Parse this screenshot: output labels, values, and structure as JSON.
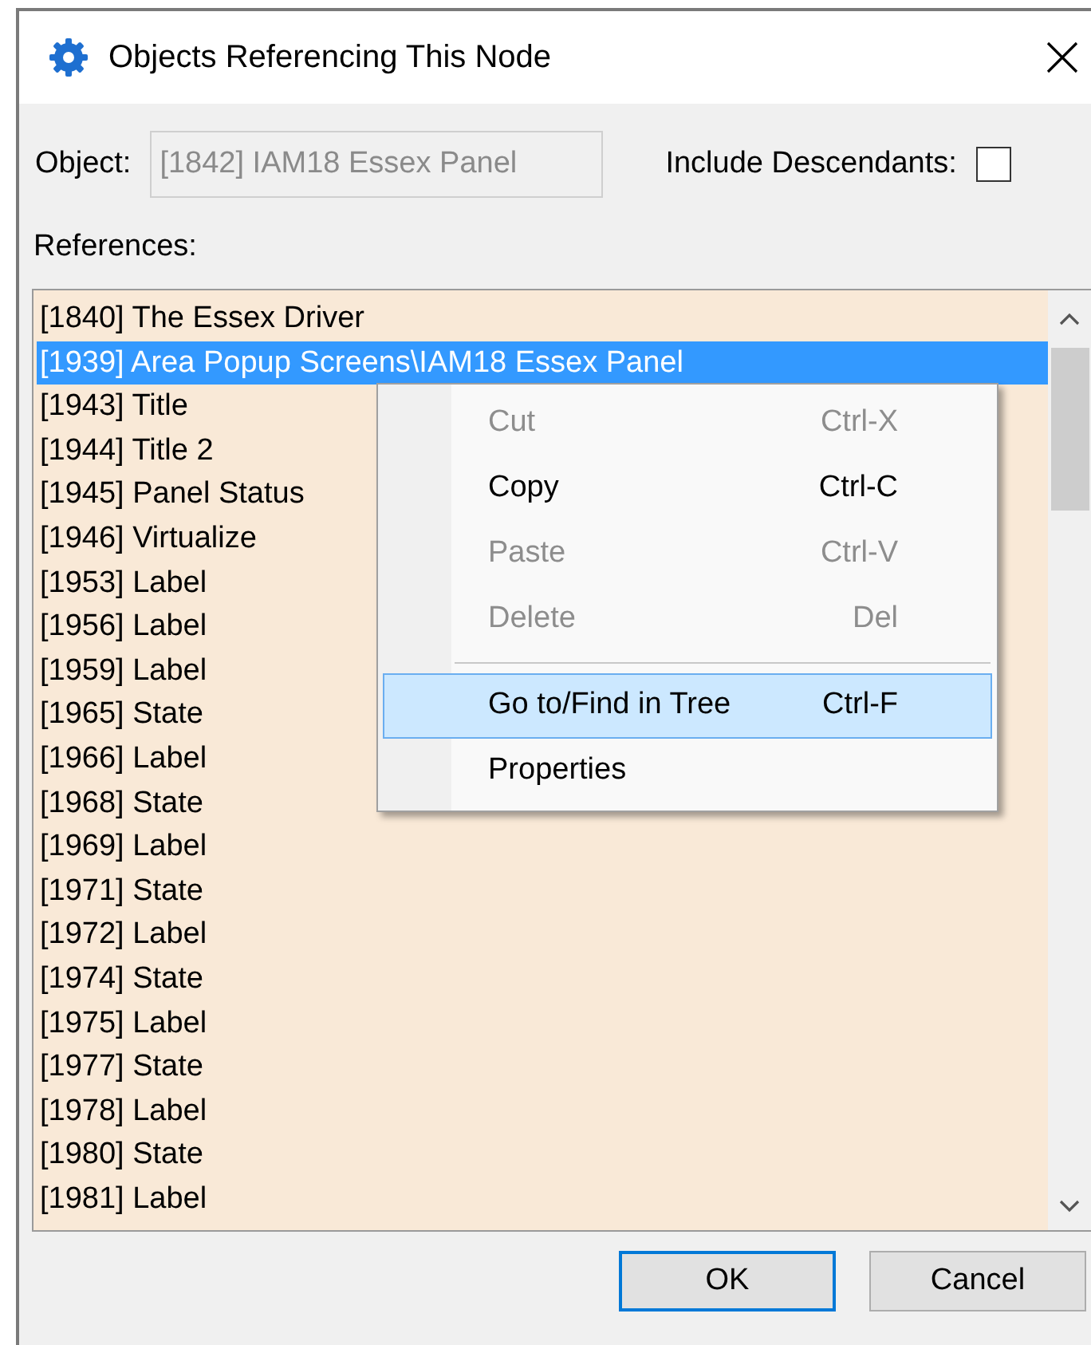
{
  "window": {
    "title": "Objects Referencing This Node"
  },
  "object_field": {
    "label": "Object:",
    "value": "[1842] IAM18 Essex Panel",
    "disabled": true
  },
  "include_descendants": {
    "label": "Include Descendants:",
    "checked": false
  },
  "references": {
    "label": "References:",
    "items": [
      {
        "text": "[1840] The Essex Driver",
        "selected": false
      },
      {
        "text": "[1939] Area Popup Screens\\IAM18 Essex Panel",
        "selected": true
      },
      {
        "text": "[1943] Title",
        "selected": false
      },
      {
        "text": "[1944] Title 2",
        "selected": false
      },
      {
        "text": "[1945] Panel Status",
        "selected": false
      },
      {
        "text": "[1946] Virtualize",
        "selected": false
      },
      {
        "text": "[1953] Label",
        "selected": false
      },
      {
        "text": "[1956] Label",
        "selected": false
      },
      {
        "text": "[1959] Label",
        "selected": false
      },
      {
        "text": "[1965] State",
        "selected": false
      },
      {
        "text": "[1966] Label",
        "selected": false
      },
      {
        "text": "[1968] State",
        "selected": false
      },
      {
        "text": "[1969] Label",
        "selected": false
      },
      {
        "text": "[1971] State",
        "selected": false
      },
      {
        "text": "[1972] Label",
        "selected": false
      },
      {
        "text": "[1974] State",
        "selected": false
      },
      {
        "text": "[1975] Label",
        "selected": false
      },
      {
        "text": "[1977] State",
        "selected": false
      },
      {
        "text": "[1978] Label",
        "selected": false
      },
      {
        "text": "[1980] State",
        "selected": false
      },
      {
        "text": "[1981] Label",
        "selected": false
      }
    ]
  },
  "context_menu": {
    "items": [
      {
        "kind": "item",
        "label": "Cut",
        "shortcut": "Ctrl-X",
        "disabled": true,
        "selected": false
      },
      {
        "kind": "item",
        "label": "Copy",
        "shortcut": "Ctrl-C",
        "disabled": false,
        "selected": false
      },
      {
        "kind": "item",
        "label": "Paste",
        "shortcut": "Ctrl-V",
        "disabled": true,
        "selected": false
      },
      {
        "kind": "item",
        "label": "Delete",
        "shortcut": "Del",
        "disabled": true,
        "selected": false
      },
      {
        "kind": "separator"
      },
      {
        "kind": "item",
        "label": "Go to/Find in Tree",
        "shortcut": "Ctrl-F",
        "disabled": false,
        "selected": true
      },
      {
        "kind": "item",
        "label": "Properties",
        "disabled": false,
        "selected": false
      }
    ]
  },
  "buttons": [
    {
      "label": "OK",
      "default": true
    },
    {
      "label": "Cancel",
      "default": false
    }
  ]
}
